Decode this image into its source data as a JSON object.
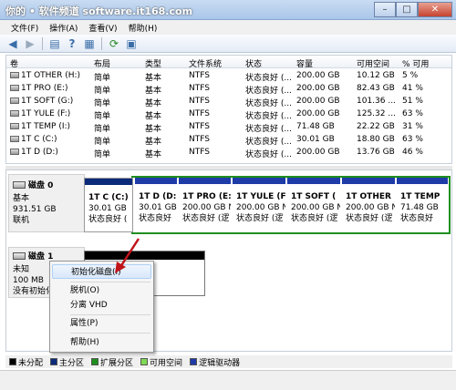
{
  "window": {
    "title": "你的 • 软件频道 software.it168.com",
    "min": "–",
    "max": "□",
    "close": "✕"
  },
  "menubar": [
    "文件(F)",
    "操作(A)",
    "查看(V)",
    "帮助(H)"
  ],
  "toolbar": [
    "back-icon",
    "forward-icon",
    "console-icon",
    "help-icon",
    "properties-icon",
    "refresh-icon",
    "settings-icon"
  ],
  "volumes": {
    "headers": [
      "卷",
      "布局",
      "类型",
      "文件系统",
      "状态",
      "容量",
      "可用空间",
      "% 可用"
    ],
    "rows": [
      [
        "1T OTHER (H:)",
        "简单",
        "基本",
        "NTFS",
        "状态良好 (...",
        "200.00 GB",
        "10.12 GB",
        "5 %"
      ],
      [
        "1T PRO (E:)",
        "简单",
        "基本",
        "NTFS",
        "状态良好 (...",
        "200.00 GB",
        "82.43 GB",
        "41 %"
      ],
      [
        "1T SOFT (G:)",
        "简单",
        "基本",
        "NTFS",
        "状态良好 (...",
        "200.00 GB",
        "101.36 ...",
        "51 %"
      ],
      [
        "1T YULE (F:)",
        "简单",
        "基本",
        "NTFS",
        "状态良好 (...",
        "200.00 GB",
        "125.32 ...",
        "63 %"
      ],
      [
        "1T TEMP (I:)",
        "简单",
        "基本",
        "NTFS",
        "状态良好 (...",
        "71.48 GB",
        "22.22 GB",
        "31 %"
      ],
      [
        "1T C (C:)",
        "简单",
        "基本",
        "NTFS",
        "状态良好 (...",
        "30.01 GB",
        "18.80 GB",
        "63 %"
      ],
      [
        "1T D (D:)",
        "简单",
        "基本",
        "NTFS",
        "状态良好 (...",
        "200.00 GB",
        "13.76 GB",
        "46 %"
      ]
    ]
  },
  "disk0": {
    "name": "磁盘 0",
    "type": "基本",
    "size": "931.51 GB",
    "status": "联机",
    "partitions": [
      {
        "name": "1T C  (C:)",
        "size": "30.01 GB",
        "status": "状态良好 (",
        "color": "#1e3ba8"
      },
      {
        "name": "1T D  (D:",
        "size": "30.01 GB",
        "status": "状态良好",
        "color": "#1e3ba8"
      },
      {
        "name": "1T PRO  (E:",
        "size": "200.00 GB N",
        "status": "状态良好 (逻",
        "color": "#1e3ba8"
      },
      {
        "name": "1T YULE  (F",
        "size": "200.00 GB N",
        "status": "状态良好 (逻",
        "color": "#1e3ba8"
      },
      {
        "name": "1T SOFT  (",
        "size": "200.00 GB N",
        "status": "状态良好 (逻",
        "color": "#1e3ba8"
      },
      {
        "name": "1T OTHER",
        "size": "200.00 GB N",
        "status": "状态良好 (逻",
        "color": "#1e3ba8"
      },
      {
        "name": "1T TEMP",
        "size": "71.48 GB",
        "status": "状态良好",
        "color": "#1e3ba8"
      }
    ]
  },
  "disk1": {
    "name": "磁盘 1",
    "type": "未知",
    "size": "100 MB",
    "status": "没有初始化"
  },
  "context_menu": [
    "初始化磁盘(I)",
    "脱机(O)",
    "分离 VHD",
    "属性(P)",
    "帮助(H)"
  ],
  "legend": [
    {
      "label": "未分配",
      "color": "#000000"
    },
    {
      "label": "主分区",
      "color": "#0b2a7a"
    },
    {
      "label": "扩展分区",
      "color": "#1f8f1f"
    },
    {
      "label": "可用空间",
      "color": "#7ed957"
    },
    {
      "label": "逻辑驱动器",
      "color": "#1e3ba8"
    }
  ]
}
